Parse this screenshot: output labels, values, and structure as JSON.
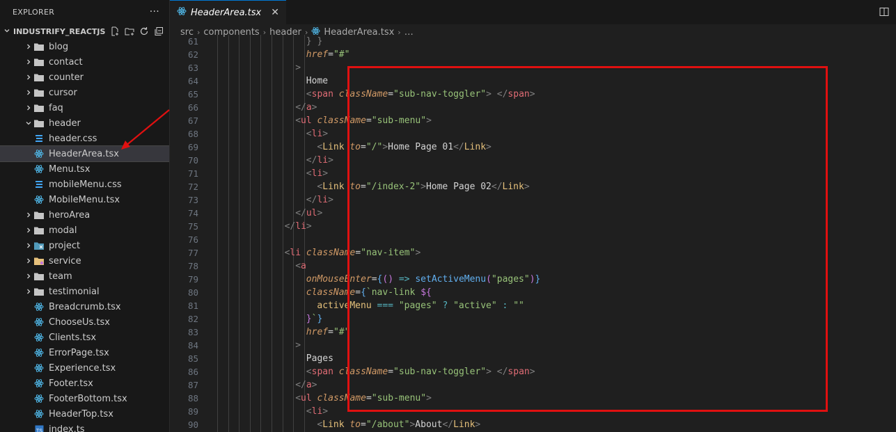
{
  "sidebar": {
    "title": "EXPLORER",
    "more": "···",
    "project": "INDUSTRIFY_REACTJS",
    "items": [
      {
        "label": "blog",
        "type": "folder",
        "open": false
      },
      {
        "label": "contact",
        "type": "folder",
        "open": false
      },
      {
        "label": "counter",
        "type": "folder",
        "open": false
      },
      {
        "label": "cursor",
        "type": "folder",
        "open": false
      },
      {
        "label": "faq",
        "type": "folder",
        "open": false
      },
      {
        "label": "header",
        "type": "folder",
        "open": true
      },
      {
        "label": "header.css",
        "type": "css",
        "indent": 1
      },
      {
        "label": "HeaderArea.tsx",
        "type": "react",
        "indent": 1,
        "selected": true
      },
      {
        "label": "Menu.tsx",
        "type": "react",
        "indent": 1
      },
      {
        "label": "mobileMenu.css",
        "type": "css",
        "indent": 1
      },
      {
        "label": "MobileMenu.tsx",
        "type": "react",
        "indent": 1
      },
      {
        "label": "heroArea",
        "type": "folder",
        "open": false
      },
      {
        "label": "modal",
        "type": "folder",
        "open": false
      },
      {
        "label": "project",
        "type": "folder-special",
        "open": false
      },
      {
        "label": "service",
        "type": "folder-yellow",
        "open": false
      },
      {
        "label": "team",
        "type": "folder",
        "open": false
      },
      {
        "label": "testimonial",
        "type": "folder",
        "open": false
      },
      {
        "label": "Breadcrumb.tsx",
        "type": "react"
      },
      {
        "label": "ChooseUs.tsx",
        "type": "react"
      },
      {
        "label": "Clients.tsx",
        "type": "react"
      },
      {
        "label": "ErrorPage.tsx",
        "type": "react"
      },
      {
        "label": "Experience.tsx",
        "type": "react"
      },
      {
        "label": "Footer.tsx",
        "type": "react"
      },
      {
        "label": "FooterBottom.tsx",
        "type": "react"
      },
      {
        "label": "HeaderTop.tsx",
        "type": "react"
      },
      {
        "label": "index.ts",
        "type": "ts"
      }
    ]
  },
  "tab": {
    "label": "HeaderArea.tsx",
    "close": "✕"
  },
  "breadcrumb": [
    "src",
    "components",
    "header",
    "HeaderArea.tsx",
    "…"
  ],
  "code_lines": [
    {
      "n": "61",
      "indent": 8,
      "segs": [
        [
          "br",
          "} }"
        ]
      ]
    },
    {
      "n": "62",
      "indent": 8,
      "segs": [
        [
          "attr",
          "href"
        ],
        [
          "t",
          "="
        ],
        [
          "str",
          "\"#\""
        ]
      ]
    },
    {
      "n": "63",
      "indent": 7,
      "segs": [
        [
          "br",
          ">"
        ]
      ]
    },
    {
      "n": "64",
      "indent": 8,
      "segs": [
        [
          "t",
          "Home"
        ]
      ]
    },
    {
      "n": "65",
      "indent": 8,
      "segs": [
        [
          "br",
          "<"
        ],
        [
          "tag",
          "span"
        ],
        [
          "t",
          " "
        ],
        [
          "attr",
          "className"
        ],
        [
          "t",
          "="
        ],
        [
          "str",
          "\"sub-nav-toggler\""
        ],
        [
          "br",
          ">"
        ],
        [
          "t",
          " "
        ],
        [
          "br",
          "</"
        ],
        [
          "tag",
          "span"
        ],
        [
          "br",
          ">"
        ]
      ]
    },
    {
      "n": "66",
      "indent": 7,
      "segs": [
        [
          "br",
          "</"
        ],
        [
          "tag",
          "a"
        ],
        [
          "br",
          ">"
        ]
      ]
    },
    {
      "n": "67",
      "indent": 7,
      "segs": [
        [
          "br",
          "<"
        ],
        [
          "tag",
          "ul"
        ],
        [
          "t",
          " "
        ],
        [
          "attr",
          "className"
        ],
        [
          "t",
          "="
        ],
        [
          "str",
          "\"sub-menu\""
        ],
        [
          "br",
          ">"
        ]
      ]
    },
    {
      "n": "68",
      "indent": 8,
      "segs": [
        [
          "br",
          "<"
        ],
        [
          "tag",
          "li"
        ],
        [
          "br",
          ">"
        ]
      ]
    },
    {
      "n": "69",
      "indent": 9,
      "segs": [
        [
          "br",
          "<"
        ],
        [
          "cmp",
          "Link"
        ],
        [
          "t",
          " "
        ],
        [
          "attr",
          "to"
        ],
        [
          "t",
          "="
        ],
        [
          "str",
          "\"/\""
        ],
        [
          "br",
          ">"
        ],
        [
          "t",
          "Home Page 01"
        ],
        [
          "br",
          "</"
        ],
        [
          "cmp",
          "Link"
        ],
        [
          "br",
          ">"
        ]
      ]
    },
    {
      "n": "70",
      "indent": 8,
      "segs": [
        [
          "br",
          "</"
        ],
        [
          "tag",
          "li"
        ],
        [
          "br",
          ">"
        ]
      ]
    },
    {
      "n": "71",
      "indent": 8,
      "segs": [
        [
          "br",
          "<"
        ],
        [
          "tag",
          "li"
        ],
        [
          "br",
          ">"
        ]
      ]
    },
    {
      "n": "72",
      "indent": 9,
      "segs": [
        [
          "br",
          "<"
        ],
        [
          "cmp",
          "Link"
        ],
        [
          "t",
          " "
        ],
        [
          "attr",
          "to"
        ],
        [
          "t",
          "="
        ],
        [
          "str",
          "\"/index-2\""
        ],
        [
          "br",
          ">"
        ],
        [
          "t",
          "Home Page 02"
        ],
        [
          "br",
          "</"
        ],
        [
          "cmp",
          "Link"
        ],
        [
          "br",
          ">"
        ]
      ]
    },
    {
      "n": "73",
      "indent": 8,
      "segs": [
        [
          "br",
          "</"
        ],
        [
          "tag",
          "li"
        ],
        [
          "br",
          ">"
        ]
      ]
    },
    {
      "n": "74",
      "indent": 7,
      "segs": [
        [
          "br",
          "</"
        ],
        [
          "tag",
          "ul"
        ],
        [
          "br",
          ">"
        ]
      ]
    },
    {
      "n": "75",
      "indent": 6,
      "segs": [
        [
          "br",
          "</"
        ],
        [
          "tag",
          "li"
        ],
        [
          "br",
          ">"
        ]
      ]
    },
    {
      "n": "76",
      "indent": 0,
      "segs": []
    },
    {
      "n": "77",
      "indent": 6,
      "segs": [
        [
          "br",
          "<"
        ],
        [
          "tag",
          "li"
        ],
        [
          "t",
          " "
        ],
        [
          "attr",
          "className"
        ],
        [
          "t",
          "="
        ],
        [
          "str",
          "\"nav-item\""
        ],
        [
          "br",
          ">"
        ]
      ]
    },
    {
      "n": "78",
      "indent": 7,
      "segs": [
        [
          "br",
          "<"
        ],
        [
          "tag",
          "a"
        ]
      ]
    },
    {
      "n": "79",
      "indent": 8,
      "segs": [
        [
          "attr",
          "onMouseEnter"
        ],
        [
          "t",
          "="
        ],
        [
          "fn",
          "{"
        ],
        [
          "kw",
          "()"
        ],
        [
          "t",
          " "
        ],
        [
          "op",
          "=>"
        ],
        [
          "t",
          " "
        ],
        [
          "fn",
          "setActiveMenu"
        ],
        [
          "kw",
          "("
        ],
        [
          "str",
          "\"pages\""
        ],
        [
          "kw",
          ")"
        ],
        [
          "fn",
          "}"
        ]
      ]
    },
    {
      "n": "80",
      "indent": 8,
      "segs": [
        [
          "attr",
          "className"
        ],
        [
          "t",
          "="
        ],
        [
          "fn",
          "{"
        ],
        [
          "tpl",
          "`nav-link "
        ],
        [
          "kw",
          "${"
        ]
      ]
    },
    {
      "n": "81",
      "indent": 9,
      "segs": [
        [
          "cmp",
          "activeMenu"
        ],
        [
          "t",
          " "
        ],
        [
          "op",
          "==="
        ],
        [
          "t",
          " "
        ],
        [
          "str",
          "\"pages\""
        ],
        [
          "t",
          " "
        ],
        [
          "op",
          "?"
        ],
        [
          "t",
          " "
        ],
        [
          "str",
          "\"active\""
        ],
        [
          "t",
          " "
        ],
        [
          "op",
          ":"
        ],
        [
          "t",
          " "
        ],
        [
          "str",
          "\"\""
        ]
      ]
    },
    {
      "n": "82",
      "indent": 8,
      "segs": [
        [
          "kw",
          "}"
        ],
        [
          "tpl",
          "`"
        ],
        [
          "fn",
          "}"
        ]
      ]
    },
    {
      "n": "83",
      "indent": 8,
      "segs": [
        [
          "attr",
          "href"
        ],
        [
          "t",
          "="
        ],
        [
          "str",
          "\"#\""
        ]
      ]
    },
    {
      "n": "84",
      "indent": 7,
      "segs": [
        [
          "br",
          ">"
        ]
      ]
    },
    {
      "n": "85",
      "indent": 8,
      "segs": [
        [
          "t",
          "Pages"
        ]
      ]
    },
    {
      "n": "86",
      "indent": 8,
      "segs": [
        [
          "br",
          "<"
        ],
        [
          "tag",
          "span"
        ],
        [
          "t",
          " "
        ],
        [
          "attr",
          "className"
        ],
        [
          "t",
          "="
        ],
        [
          "str",
          "\"sub-nav-toggler\""
        ],
        [
          "br",
          ">"
        ],
        [
          "t",
          " "
        ],
        [
          "br",
          "</"
        ],
        [
          "tag",
          "span"
        ],
        [
          "br",
          ">"
        ]
      ]
    },
    {
      "n": "87",
      "indent": 7,
      "segs": [
        [
          "br",
          "</"
        ],
        [
          "tag",
          "a"
        ],
        [
          "br",
          ">"
        ]
      ]
    },
    {
      "n": "88",
      "indent": 7,
      "segs": [
        [
          "br",
          "<"
        ],
        [
          "tag",
          "ul"
        ],
        [
          "t",
          " "
        ],
        [
          "attr",
          "className"
        ],
        [
          "t",
          "="
        ],
        [
          "str",
          "\"sub-menu\""
        ],
        [
          "br",
          ">"
        ]
      ]
    },
    {
      "n": "89",
      "indent": 8,
      "segs": [
        [
          "br",
          "<"
        ],
        [
          "tag",
          "li"
        ],
        [
          "br",
          ">"
        ]
      ]
    },
    {
      "n": "90",
      "indent": 9,
      "segs": [
        [
          "br",
          "<"
        ],
        [
          "cmp",
          "Link"
        ],
        [
          "t",
          " "
        ],
        [
          "attr",
          "to"
        ],
        [
          "t",
          "="
        ],
        [
          "str",
          "\"/about\""
        ],
        [
          "br",
          ">"
        ],
        [
          "t",
          "About"
        ],
        [
          "br",
          "</"
        ],
        [
          "cmp",
          "Link"
        ],
        [
          "br",
          ">"
        ]
      ]
    }
  ]
}
